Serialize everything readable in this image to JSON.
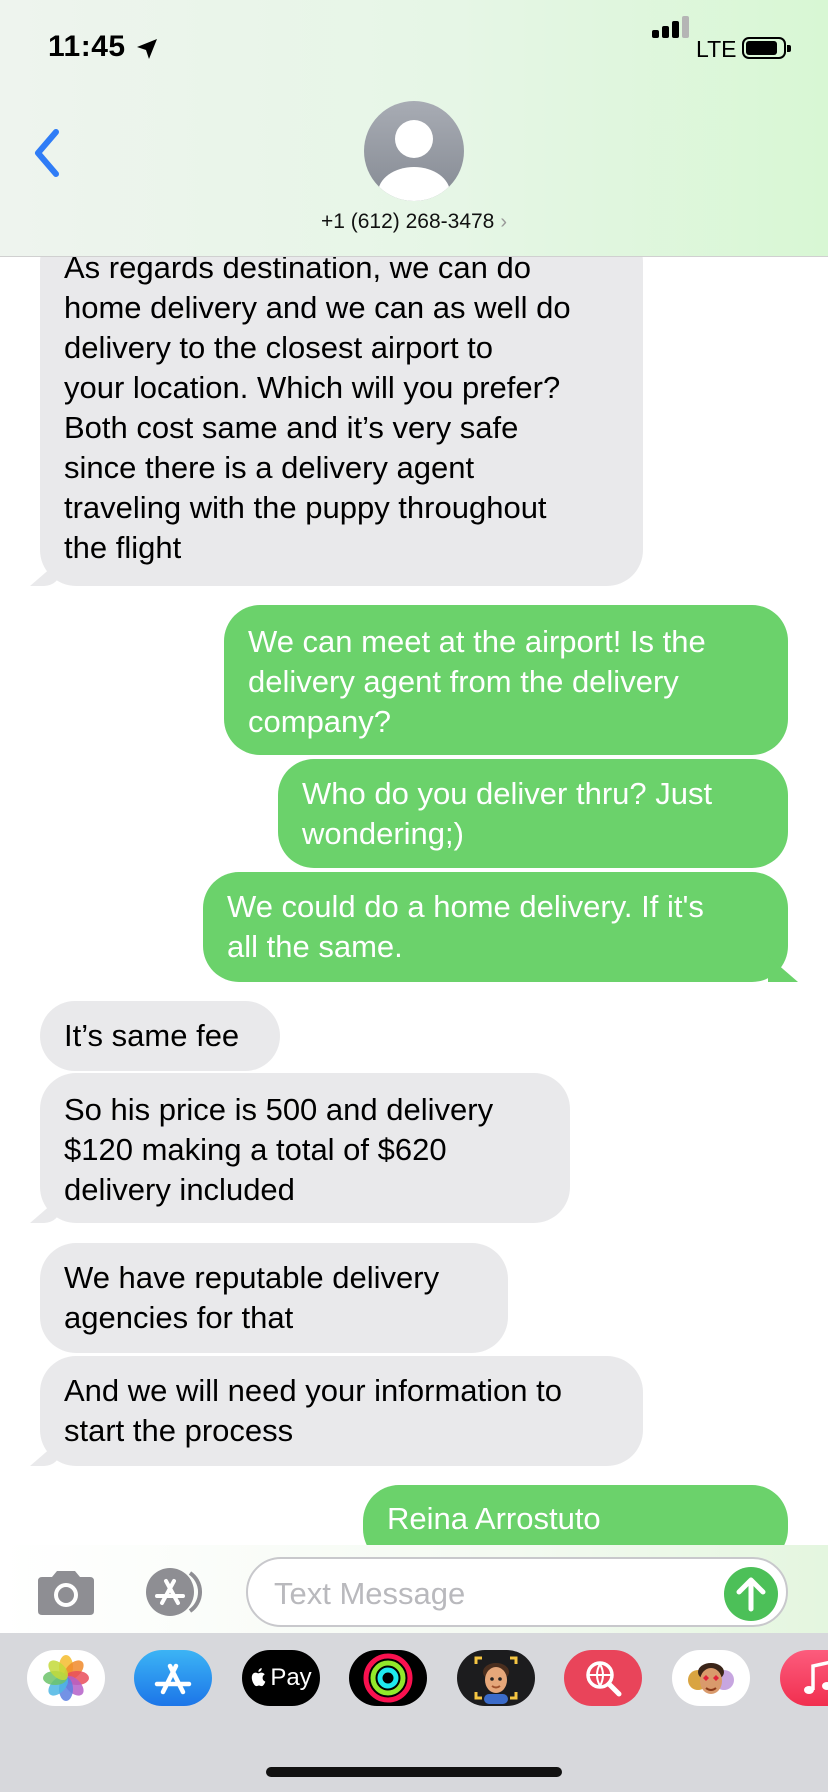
{
  "status_bar": {
    "time": "11:45",
    "network": "LTE"
  },
  "header": {
    "contact": "+1 (612) 268-3478"
  },
  "messages": [
    {
      "side": "received",
      "text": "As regards destination, we can do\nhome delivery and we can as well do\ndelivery to the closest airport to\nyour location. Which will you prefer?\nBoth cost same and it’s very safe\nsince there is a delivery agent\ntraveling with the puppy throughout\nthe flight"
    },
    {
      "side": "sent",
      "text": "We can meet at the airport! Is the\ndelivery agent from the delivery\ncompany?"
    },
    {
      "side": "sent",
      "text": "Who do you deliver thru? Just\nwondering;)"
    },
    {
      "side": "sent",
      "text": "We could do a home delivery. If it's\nall the same."
    },
    {
      "side": "received",
      "text": "It’s same fee"
    },
    {
      "side": "received",
      "text": "So his price is 500 and delivery\n$120 making a total of $620\ndelivery included"
    },
    {
      "side": "received",
      "text": "We have reputable delivery\nagencies for that"
    },
    {
      "side": "received",
      "text": "And we will need your information to\nstart the process"
    },
    {
      "side": "sent",
      "text": "Reina Arrostuto"
    }
  ],
  "compose": {
    "placeholder": "Text Message"
  },
  "app_drawer": {
    "items": [
      "photos-icon",
      "app-store-icon",
      "apple-pay-icon",
      "activity-icon",
      "memoji-icon",
      "image-search-icon",
      "animoji-icon",
      "music-icon"
    ],
    "apple_pay_label": "Pay"
  },
  "colors": {
    "sent_bubble": "#6bd26b",
    "received_bubble": "#e9e9eb",
    "accent": "#2f7cf6",
    "send_button": "#4cc058"
  }
}
